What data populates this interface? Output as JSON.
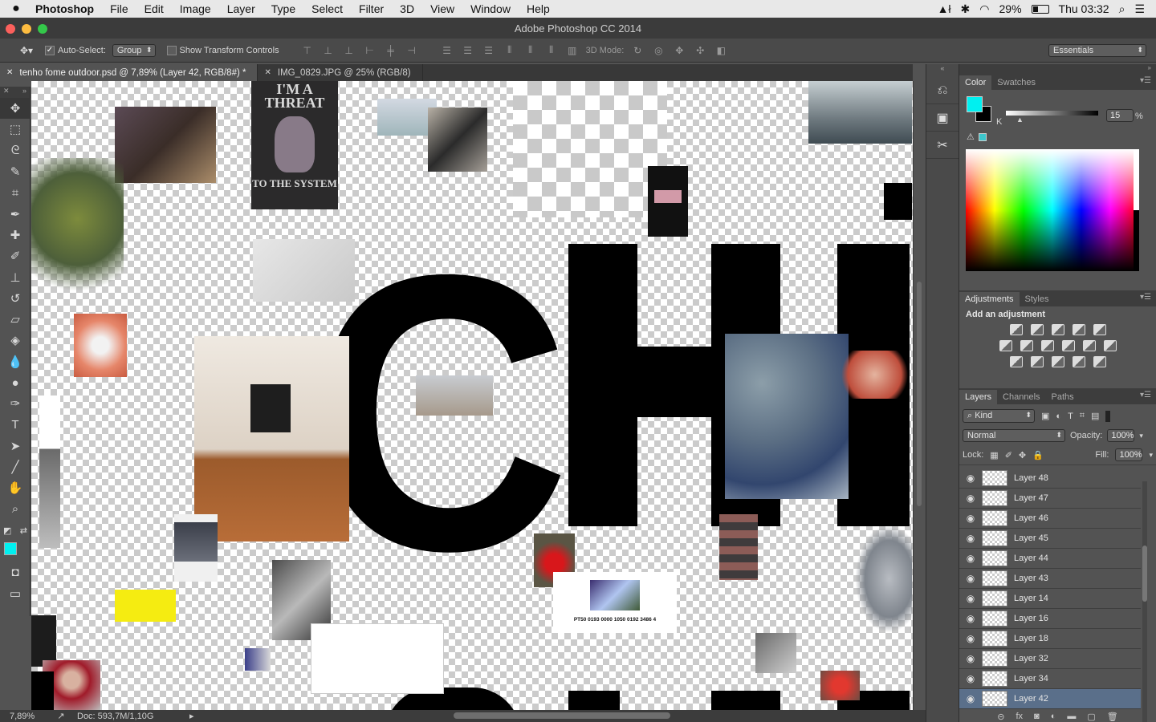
{
  "menubar": {
    "app": "Photoshop",
    "items": [
      "File",
      "Edit",
      "Image",
      "Layer",
      "Type",
      "Select",
      "Filter",
      "3D",
      "View",
      "Window",
      "Help"
    ],
    "battery": "29%",
    "clock": "Thu 03:32"
  },
  "window": {
    "title": "Adobe Photoshop CC 2014"
  },
  "options": {
    "auto_select_label": "Auto-Select:",
    "auto_select_value": "Group",
    "show_transform_label": "Show Transform Controls",
    "mode_3d_label": "3D Mode:",
    "workspace": "Essentials"
  },
  "tabs": [
    {
      "label": "tenho fome outdoor.psd @ 7,89% (Layer 42, RGB/8#) *"
    },
    {
      "label": "IMG_0829.JPG @ 25% (RGB/8)"
    }
  ],
  "canvas": {
    "big_text": [
      "C",
      "H",
      "H"
    ],
    "caption_iban": "PT50 0193 0000 1050 0192 3486 4",
    "poster_text_top": "I'M A THREAT",
    "poster_text_bottom": "TO THE SYSTEM"
  },
  "status": {
    "zoom": "7,89%",
    "doc": "Doc: 593,7M/1,10G"
  },
  "color_panel": {
    "tabs": [
      "Color",
      "Swatches"
    ],
    "channel": "K",
    "value": "15",
    "unit": "%",
    "foreground": "#00f0f0",
    "background": "#000000"
  },
  "adjustments_panel": {
    "tabs": [
      "Adjustments",
      "Styles"
    ],
    "hint": "Add an adjustment"
  },
  "layers_panel": {
    "tabs": [
      "Layers",
      "Channels",
      "Paths"
    ],
    "filter": "Kind",
    "blend_mode": "Normal",
    "opacity_label": "Opacity:",
    "opacity": "100%",
    "lock_label": "Lock:",
    "fill_label": "Fill:",
    "fill": "100%",
    "layers": [
      {
        "name": "Layer 48"
      },
      {
        "name": "Layer 47"
      },
      {
        "name": "Layer 46"
      },
      {
        "name": "Layer 45"
      },
      {
        "name": "Layer 44"
      },
      {
        "name": "Layer 43"
      },
      {
        "name": "Layer 14"
      },
      {
        "name": "Layer 16"
      },
      {
        "name": "Layer 18"
      },
      {
        "name": "Layer 32"
      },
      {
        "name": "Layer 34"
      },
      {
        "name": "Layer 42"
      }
    ],
    "selected": "Layer 42"
  }
}
